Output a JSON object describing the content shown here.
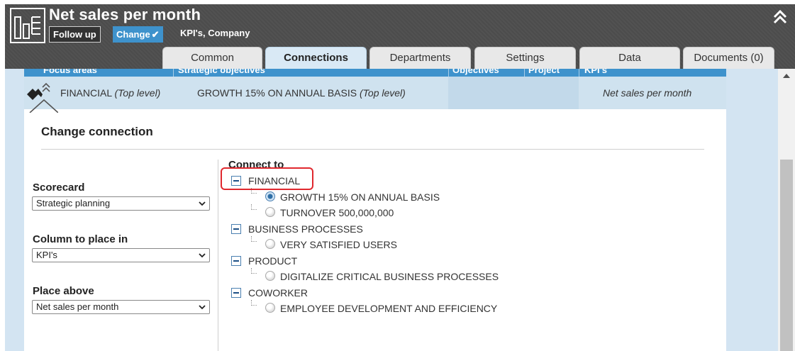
{
  "header": {
    "title": "Net sales per month",
    "follow_up_label": "Follow up",
    "change_label": "Change",
    "subtitle": "KPI's, Company",
    "app_icon": "kpi-chart-icon",
    "collapse_icon": "double-chevron-up-icon"
  },
  "tabs": [
    {
      "label": "Common",
      "active": false
    },
    {
      "label": "Connections",
      "active": true
    },
    {
      "label": "Departments",
      "active": false
    },
    {
      "label": "Settings",
      "active": false
    },
    {
      "label": "Data",
      "active": false
    },
    {
      "label": "Documents (0)",
      "active": false
    }
  ],
  "table": {
    "headers": [
      "Focus areas",
      "Strategic objectives",
      "Objectives",
      "Project",
      "KPI's"
    ],
    "row": {
      "focus_area": "FINANCIAL",
      "focus_area_suffix": "(Top level)",
      "strategic_objective": "GROWTH 15% ON ANNUAL BASIS",
      "strategic_objective_suffix": "(Top level)",
      "objectives": "",
      "project": "",
      "kpi": "Net sales per month"
    }
  },
  "change_connection": {
    "title": "Change connection",
    "scorecard_label": "Scorecard",
    "scorecard_value": "Strategic planning",
    "column_label": "Column to place in",
    "column_value": "KPI's",
    "place_above_label": "Place above",
    "place_above_value": "Net sales per month",
    "connect_to_label": "Connect to",
    "tree": [
      {
        "label": "FINANCIAL",
        "children": [
          {
            "label": "GROWTH 15% ON ANNUAL BASIS",
            "checked": true
          },
          {
            "label": "TURNOVER 500,000,000",
            "checked": false
          }
        ]
      },
      {
        "label": "BUSINESS PROCESSES",
        "children": [
          {
            "label": "VERY SATISFIED USERS",
            "checked": false
          }
        ]
      },
      {
        "label": "PRODUCT",
        "children": [
          {
            "label": "DIGITALIZE CRITICAL BUSINESS PROCESSES",
            "checked": false
          }
        ]
      },
      {
        "label": "COWORKER",
        "children": [
          {
            "label": "EMPLOYEE DEVELOPMENT AND EFFICIENCY",
            "checked": false
          }
        ]
      }
    ]
  },
  "colors": {
    "header_bg": "#4e4e4e",
    "accent": "#3e92cc",
    "row_bg": "#cfe2ef",
    "highlight": "#e0282e"
  }
}
